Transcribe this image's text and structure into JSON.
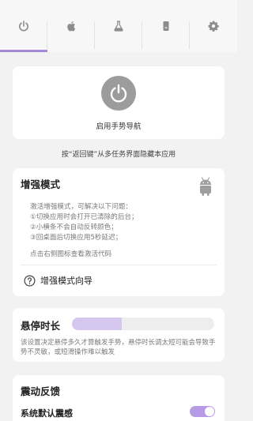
{
  "tabs": [
    {
      "icon": "power-icon",
      "active": true
    },
    {
      "icon": "apple-icon",
      "active": false
    },
    {
      "icon": "flask-icon",
      "active": false
    },
    {
      "icon": "phone-icon",
      "active": false
    },
    {
      "icon": "gear-icon",
      "active": false
    }
  ],
  "power": {
    "label": "启用手势导航"
  },
  "hint": "按“返回键”从多任务界面隐藏本应用",
  "enhance": {
    "title": "增强模式",
    "lines": [
      "激活增强模式，可解决以下问题：",
      "①切换应用时会打开已清除的后台；",
      "②小横条不会自动反转颜色；",
      "③回桌面后切换应用5秒延迟；"
    ],
    "tip": "点击右侧图标查看激活代码",
    "guide": "增强模式向导"
  },
  "hover": {
    "title": "悬停时长",
    "level": 0.35,
    "desc": "该设置决定悬停多久才算触发手势，悬停时长调太短可能会导致手势不灵敏，或短滑操作难以触发"
  },
  "vibrate": {
    "title": "震动反馈",
    "row_label": "系统默认震感",
    "enabled": true
  },
  "colors": {
    "accent": "#a58ad8",
    "slider": "#d5c7f0",
    "toggle": "#b79be6"
  }
}
